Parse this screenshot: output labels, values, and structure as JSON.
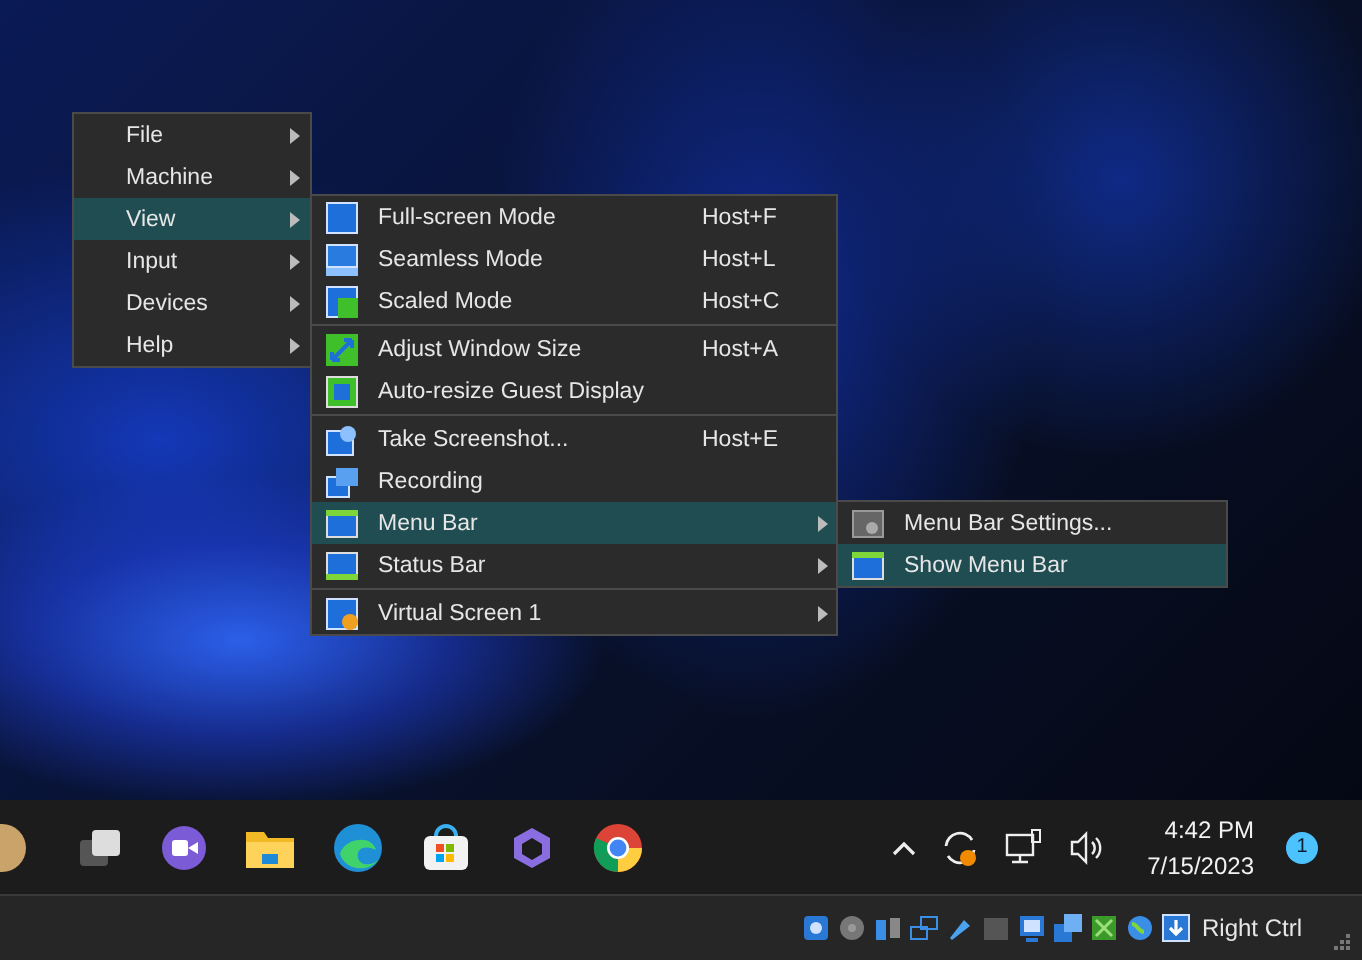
{
  "main_menu": {
    "items": [
      {
        "label": "File",
        "selected": false
      },
      {
        "label": "Machine",
        "selected": false
      },
      {
        "label": "View",
        "selected": true
      },
      {
        "label": "Input",
        "selected": false
      },
      {
        "label": "Devices",
        "selected": false
      },
      {
        "label": "Help",
        "selected": false
      }
    ]
  },
  "view_menu": {
    "groups": [
      {
        "items": [
          {
            "kind": "fullscreen",
            "label": "Full-screen Mode",
            "shortcut": "Host+F",
            "selected": false,
            "submenu": false
          },
          {
            "kind": "seamless",
            "label": "Seamless Mode",
            "shortcut": "Host+L",
            "selected": false,
            "submenu": false
          },
          {
            "kind": "scaled",
            "label": "Scaled Mode",
            "shortcut": "Host+C",
            "selected": false,
            "submenu": false
          }
        ]
      },
      {
        "items": [
          {
            "kind": "adjust",
            "label": "Adjust Window Size",
            "shortcut": "Host+A",
            "selected": false,
            "submenu": false
          },
          {
            "kind": "autoresize",
            "label": "Auto-resize Guest Display",
            "selected": false,
            "submenu": false
          }
        ]
      },
      {
        "items": [
          {
            "kind": "screenshot",
            "label": "Take Screenshot...",
            "shortcut": "Host+E",
            "selected": false,
            "submenu": false
          },
          {
            "kind": "recording",
            "label": "Recording",
            "selected": false,
            "submenu": false
          },
          {
            "kind": "menubar",
            "label": "Menu Bar",
            "selected": true,
            "submenu": true
          },
          {
            "kind": "statusbar",
            "label": "Status Bar",
            "selected": false,
            "submenu": true
          }
        ]
      },
      {
        "items": [
          {
            "kind": "screen",
            "label": "Virtual Screen 1",
            "selected": false,
            "submenu": true
          }
        ]
      }
    ]
  },
  "menu_bar_menu": {
    "items": [
      {
        "kind": "settings",
        "label": "Menu Bar Settings...",
        "selected": false
      },
      {
        "kind": "menubar",
        "label": "Show Menu Bar",
        "selected": true
      }
    ]
  },
  "taskbar": {
    "time": "4:42 PM",
    "date": "7/15/2023",
    "notification_count": "1"
  },
  "status_bar": {
    "host_key": "Right Ctrl"
  }
}
